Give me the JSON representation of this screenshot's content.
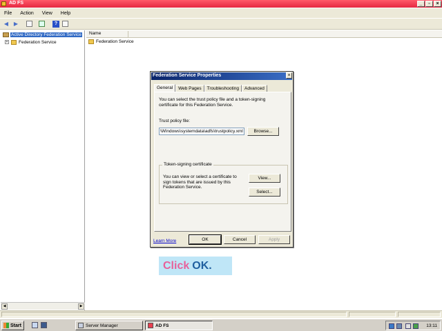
{
  "window": {
    "title": "AD FS",
    "min": "_",
    "max": "▫",
    "close": "×"
  },
  "menu": [
    "File",
    "Action",
    "View",
    "Help"
  ],
  "toolbar": {
    "back": "◀",
    "forward": "▶",
    "help": "?"
  },
  "tree": {
    "root": "Active Directory Federation Service",
    "child": "Federation Service",
    "expander": "+"
  },
  "list": {
    "column": "Name",
    "items": [
      "Federation Service"
    ]
  },
  "dialog": {
    "title": "Federation Service Properties",
    "close": "×",
    "tabs": [
      "General",
      "Web Pages",
      "Troubleshooting",
      "Advanced"
    ],
    "intro": "You can select the trust policy file and a token-signing certificate for this Federation Service.",
    "trust_label": "Trust policy file:",
    "trust_value": "\\Windows\\systemdata\\adfs\\trustpolicy.xml",
    "browse": "Browse...",
    "group_title": "Token-signing certificate",
    "group_text": "You can view or select a certificate to sign tokens that are issued by this Federation Service.",
    "view": "View...",
    "select": "Select...",
    "learn_more": "Learn More",
    "ok": "OK",
    "cancel": "Cancel",
    "apply": "Apply"
  },
  "callout": {
    "click": "Click",
    "ok": "OK."
  },
  "taskbar": {
    "start": "Start",
    "tasks": [
      "Server Manager",
      "AD FS"
    ],
    "clock": "13:11"
  }
}
